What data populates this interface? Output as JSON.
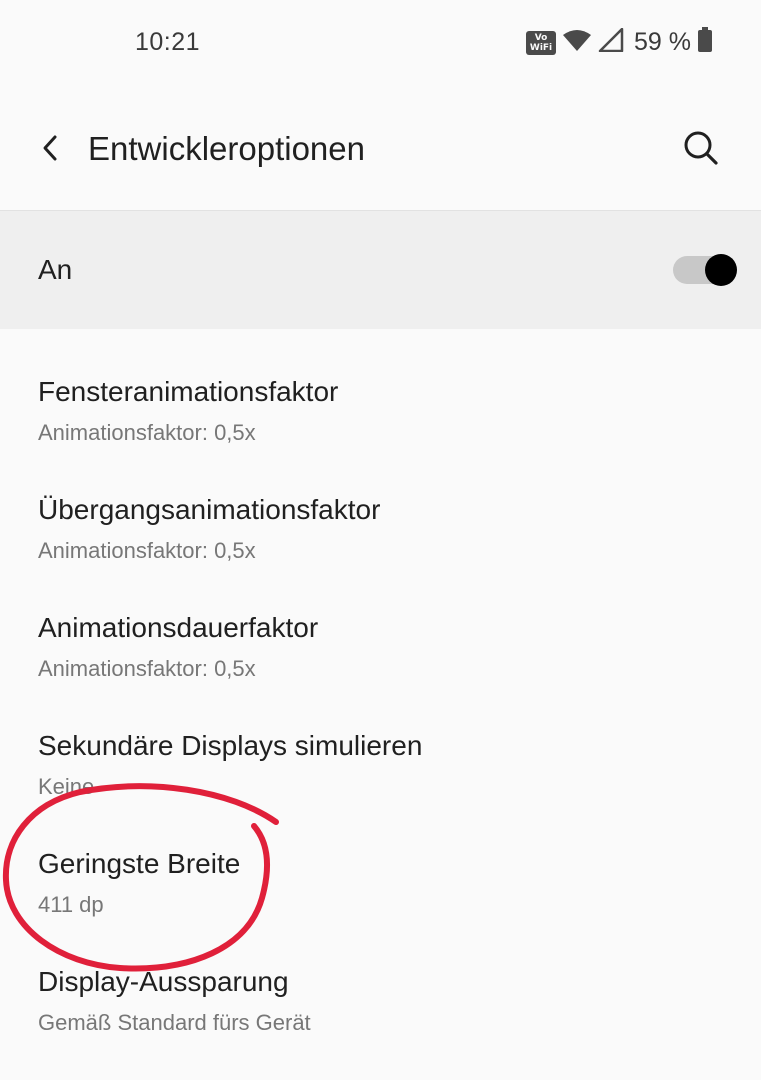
{
  "status_bar": {
    "time": "10:21",
    "vowifi_top": "Vo",
    "vowifi_bottom": "WiFi",
    "battery_percent": "59 %",
    "icons": [
      "vowifi-icon",
      "wifi-icon",
      "signal-icon",
      "battery-icon"
    ]
  },
  "toolbar": {
    "title": "Entwickleroptionen",
    "back_icon": "back-arrow-icon",
    "search_icon": "search-icon"
  },
  "master_switch": {
    "label": "An",
    "enabled": true
  },
  "settings": [
    {
      "title": "Fensteranimationsfaktor",
      "summary": "Animationsfaktor: 0,5x"
    },
    {
      "title": "Übergangsanimationsfaktor",
      "summary": "Animationsfaktor: 0,5x"
    },
    {
      "title": "Animationsdauerfaktor",
      "summary": "Animationsfaktor: 0,5x"
    },
    {
      "title": "Sekundäre Displays simulieren",
      "summary": "Keine"
    },
    {
      "title": "Geringste Breite",
      "summary": "411 dp"
    },
    {
      "title": "Display-Aussparung",
      "summary": "Gemäß Standard fürs Gerät"
    }
  ],
  "colors": {
    "background": "#fafafa",
    "master_row": "#efefef",
    "annotation": "#e0203a",
    "toggle_track": "#c8c8c8",
    "toggle_thumb": "#000000"
  }
}
